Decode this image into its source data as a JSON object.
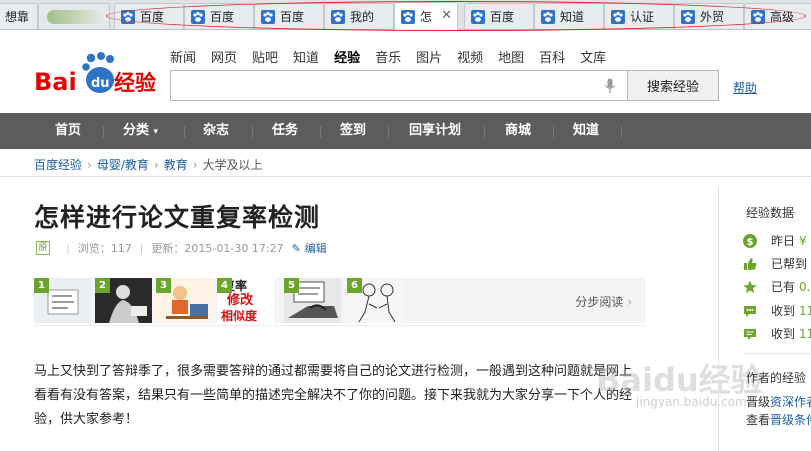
{
  "tabs": [
    {
      "title": "想靠",
      "active": false,
      "blurred": true
    },
    {
      "title": "百度",
      "active": false
    },
    {
      "title": "百度",
      "active": false
    },
    {
      "title": "百度",
      "active": false
    },
    {
      "title": "我的",
      "active": false
    },
    {
      "title": "怎",
      "active": true,
      "close": "✕"
    },
    {
      "title": "百度",
      "active": false
    },
    {
      "title": "知道",
      "active": false
    },
    {
      "title": "认证",
      "active": false
    },
    {
      "title": "外贸",
      "active": false
    },
    {
      "title": "高级",
      "active": false
    }
  ],
  "logo": {
    "bai": "Bai",
    "du": "du",
    "jingyan": "经验",
    "brand_red": "#e10602",
    "brand_blue": "#2c73c9"
  },
  "topnav": [
    "新闻",
    "网页",
    "贴吧",
    "知道",
    "经验",
    "音乐",
    "图片",
    "视频",
    "地图",
    "百科",
    "文库"
  ],
  "topnav_current": "经验",
  "search": {
    "value": "",
    "button": "搜索经验",
    "help": "帮助"
  },
  "mainnav": [
    "首页",
    "分类",
    "杂志",
    "任务",
    "签到",
    "回享计划",
    "商城",
    "知道"
  ],
  "breadcrumb": [
    "百度经验",
    "母婴/教育",
    "教育",
    "大学及以上"
  ],
  "article": {
    "title": "怎样进行论文重复率检测",
    "badge": "原",
    "views_label": "浏览：117",
    "updated_label": "更新：2015-01-30 17:27",
    "edit": "编辑",
    "step_read": "分步阅读",
    "steps": [
      "1",
      "2",
      "3",
      "4",
      "5",
      "6"
    ],
    "step3_text": [
      "复率",
      "修改",
      "相似度"
    ],
    "paragraph": "马上又快到了答辩季了，很多需要答辩的通过都需要将自己的论文进行检测，一般遇到这种问题就是网上看看有没有答案，结果只有一些简单的描述完全解决不了你的问题。接下来我就为大家分享一下个人的经验，供大家参考！"
  },
  "watermark": {
    "text": "Baidu经验",
    "url": "jingyan.baidu.com"
  },
  "sidebar": {
    "heading": "经验数据",
    "rows": [
      {
        "icon": "coin-icon",
        "text": "昨日",
        "value": "¥"
      },
      {
        "icon": "thumb-icon",
        "text": "已帮到",
        "value": ""
      },
      {
        "icon": "star-icon",
        "text": "已有",
        "value": "0."
      },
      {
        "icon": "chat-icon",
        "text": "收到",
        "value": "11"
      },
      {
        "icon": "comment-icon",
        "text": "收到",
        "value": "11"
      }
    ],
    "author_heading": "作者的经验",
    "line1_prefix": "晋级",
    "line1_link": "资深作者",
    "line2_prefix": "查看",
    "line2_link": "晋级条件"
  },
  "colors": {
    "navbar": "#5c5c5c",
    "green": "#6ba52b",
    "link": "#1d5ea6"
  }
}
